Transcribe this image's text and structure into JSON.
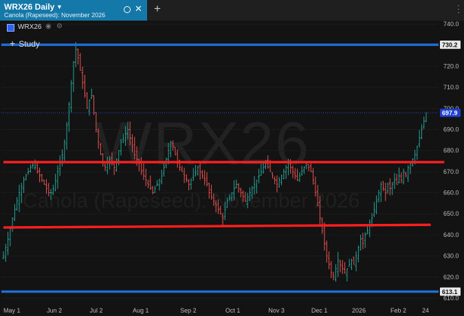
{
  "tab": {
    "title": "WRX26 Daily",
    "subtitle": "Canola (Rapeseed): November 2026"
  },
  "legend": {
    "symbol": "WRX26"
  },
  "study": {
    "label": "Study"
  },
  "watermark": {
    "symbol": "WRX26",
    "name": "Canola (Rapeseed): November 2026"
  },
  "colors": {
    "up": "#26a69a",
    "down": "#ef5350",
    "level_line": "#1e6ed6",
    "trend_line": "#ff1e1e",
    "last_price": "#1e4ddc",
    "background": "#131313"
  },
  "icons": [
    "dropdown-caret-icon",
    "circle-icon",
    "close-icon",
    "plus-icon",
    "kebab-menu-icon",
    "eye-icon",
    "gear-icon"
  ],
  "chart_data": {
    "type": "candlestick",
    "symbol": "WRX26",
    "interval": "Daily",
    "y_range": [
      609,
      742
    ],
    "y_ticks": [
      610,
      620,
      630,
      640,
      650,
      660,
      670,
      680,
      690,
      700,
      710,
      720,
      730,
      740
    ],
    "y_tick_labels": [
      "610.0",
      "620.0",
      "630.0",
      "640.0",
      "650.0",
      "660.0",
      "670.0",
      "680.0",
      "690.0",
      "700.0",
      "710.0",
      "720.0",
      "730.0",
      "740.0"
    ],
    "x_labels": [
      "May 1",
      "Jun 2",
      "Jul 2",
      "Aug 1",
      "Sep 2",
      "Oct 1",
      "Nov 3",
      "Dec 1",
      "2026",
      "Feb 2",
      "24"
    ],
    "horizontal_levels": [
      730.2,
      613.1
    ],
    "last_price": 697.9,
    "trend_lines": [
      {
        "from_index": 0,
        "from_price": 674.5,
        "to_index": 195,
        "to_price": 674.5
      },
      {
        "from_index": 0,
        "from_price": 643.5,
        "to_index": 189,
        "to_price": 644.8
      }
    ],
    "closes": [
      630,
      634,
      638,
      643,
      648,
      652,
      656,
      660,
      663,
      666,
      668,
      670,
      672,
      673,
      672,
      670,
      668,
      666,
      664,
      662,
      660,
      660,
      662,
      666,
      670,
      674,
      678,
      684,
      692,
      702,
      712,
      722,
      728,
      724,
      718,
      712,
      706,
      700,
      704,
      706,
      698,
      690,
      684,
      678,
      674,
      672,
      674,
      676,
      674,
      672,
      676,
      680,
      684,
      686,
      688,
      690,
      686,
      682,
      678,
      676,
      674,
      670,
      668,
      666,
      664,
      662,
      660,
      662,
      664,
      666,
      668,
      672,
      676,
      680,
      684,
      682,
      678,
      674,
      672,
      670,
      668,
      666,
      664,
      666,
      668,
      670,
      672,
      670,
      668,
      666,
      664,
      660,
      658,
      656,
      654,
      652,
      650,
      648,
      652,
      656,
      658,
      660,
      662,
      664,
      662,
      660,
      658,
      656,
      658,
      660,
      662,
      664,
      666,
      668,
      670,
      672,
      674,
      672,
      670,
      668,
      666,
      664,
      666,
      668,
      670,
      672,
      674,
      672,
      670,
      668,
      666,
      668,
      670,
      672,
      674,
      672,
      670,
      666,
      660,
      654,
      648,
      642,
      636,
      630,
      626,
      622,
      620,
      624,
      628,
      626,
      624,
      622,
      624,
      626,
      628,
      626,
      630,
      634,
      638,
      636,
      640,
      642,
      646,
      648,
      652,
      656,
      660,
      664,
      662,
      660,
      664,
      662,
      664,
      666,
      664,
      668,
      666,
      670,
      668,
      672,
      674,
      676,
      678,
      682,
      686,
      690,
      694,
      697.9
    ]
  },
  "price_badges": [
    {
      "label": "730.2",
      "value": 730.2
    },
    {
      "label": "697.9",
      "value": 697.9
    },
    {
      "label": "613.1",
      "value": 613.1
    }
  ]
}
